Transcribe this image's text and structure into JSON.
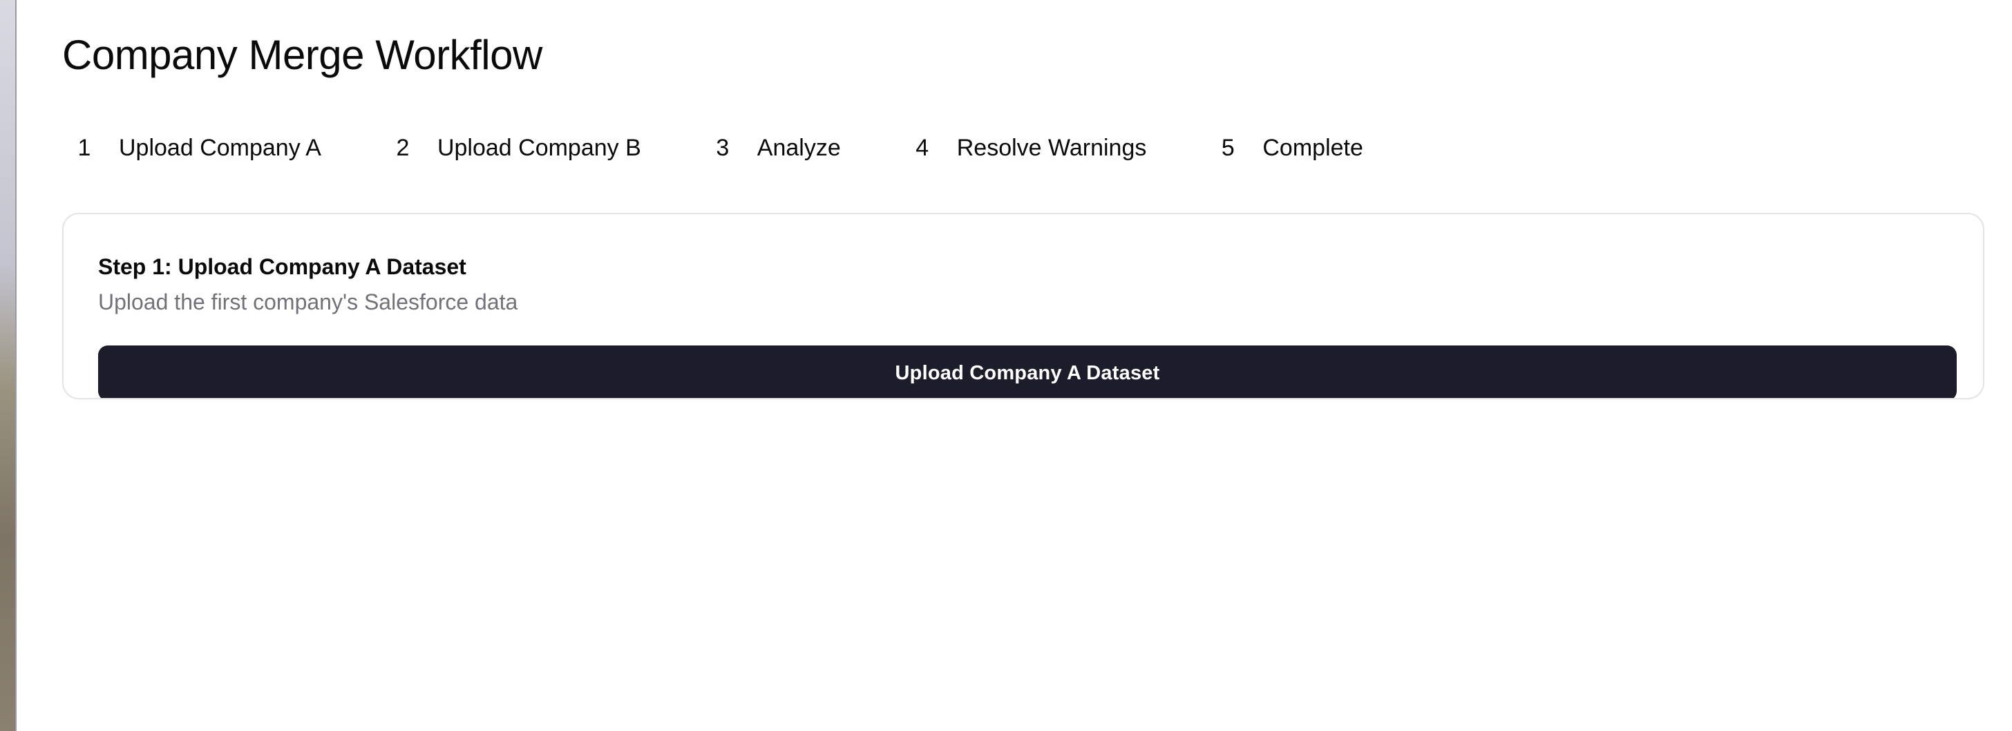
{
  "page": {
    "title": "Company Merge Workflow"
  },
  "steps": [
    {
      "number": "1",
      "label": "Upload Company A"
    },
    {
      "number": "2",
      "label": "Upload Company B"
    },
    {
      "number": "3",
      "label": "Analyze"
    },
    {
      "number": "4",
      "label": "Resolve Warnings"
    },
    {
      "number": "5",
      "label": "Complete"
    }
  ],
  "card": {
    "title": "Step 1: Upload Company A Dataset",
    "description": "Upload the first company's Salesforce data",
    "button_label": "Upload Company A Dataset"
  },
  "colors": {
    "primary_button": "#1c1c2a",
    "muted_text": "#71717a",
    "border": "#e4e4e7"
  }
}
